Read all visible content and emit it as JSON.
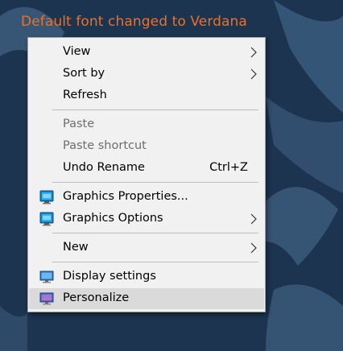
{
  "caption": "Default font changed to Verdana",
  "menu": {
    "items": [
      {
        "label": "View",
        "submenu": true
      },
      {
        "label": "Sort by",
        "submenu": true
      },
      {
        "label": "Refresh"
      },
      {
        "label": "Paste",
        "disabled": true
      },
      {
        "label": "Paste shortcut",
        "disabled": true
      },
      {
        "label": "Undo Rename",
        "shortcut": "Ctrl+Z"
      },
      {
        "label": "Graphics Properties...",
        "icon": "graphics-icon"
      },
      {
        "label": "Graphics Options",
        "icon": "graphics-icon",
        "submenu": true
      },
      {
        "label": "New",
        "submenu": true
      },
      {
        "label": "Display settings",
        "icon": "display-icon"
      },
      {
        "label": "Personalize",
        "icon": "personalize-icon",
        "highlighted": true
      }
    ]
  },
  "colors": {
    "caption": "#e8722a",
    "wallpaper": "#1d3450",
    "menu_background": "#f1f1f1",
    "highlight": "#dadada"
  }
}
